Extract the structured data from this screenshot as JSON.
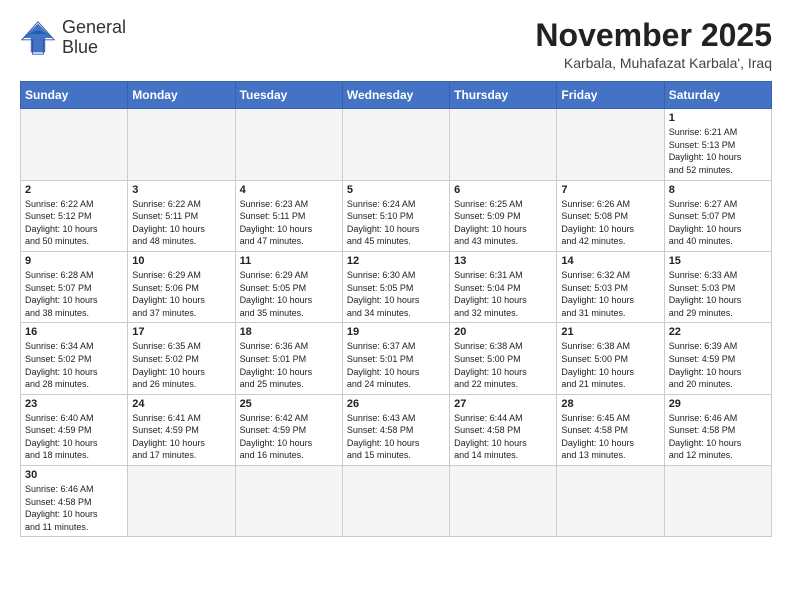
{
  "header": {
    "logo_line1": "General",
    "logo_line2": "Blue",
    "month_title": "November 2025",
    "location": "Karbala, Muhafazat Karbala', Iraq"
  },
  "weekdays": [
    "Sunday",
    "Monday",
    "Tuesday",
    "Wednesday",
    "Thursday",
    "Friday",
    "Saturday"
  ],
  "days": [
    {
      "date": "",
      "info": ""
    },
    {
      "date": "",
      "info": ""
    },
    {
      "date": "",
      "info": ""
    },
    {
      "date": "",
      "info": ""
    },
    {
      "date": "",
      "info": ""
    },
    {
      "date": "",
      "info": ""
    },
    {
      "date": "1",
      "info": "Sunrise: 6:21 AM\nSunset: 5:13 PM\nDaylight: 10 hours\nand 52 minutes."
    },
    {
      "date": "2",
      "info": "Sunrise: 6:22 AM\nSunset: 5:12 PM\nDaylight: 10 hours\nand 50 minutes."
    },
    {
      "date": "3",
      "info": "Sunrise: 6:22 AM\nSunset: 5:11 PM\nDaylight: 10 hours\nand 48 minutes."
    },
    {
      "date": "4",
      "info": "Sunrise: 6:23 AM\nSunset: 5:11 PM\nDaylight: 10 hours\nand 47 minutes."
    },
    {
      "date": "5",
      "info": "Sunrise: 6:24 AM\nSunset: 5:10 PM\nDaylight: 10 hours\nand 45 minutes."
    },
    {
      "date": "6",
      "info": "Sunrise: 6:25 AM\nSunset: 5:09 PM\nDaylight: 10 hours\nand 43 minutes."
    },
    {
      "date": "7",
      "info": "Sunrise: 6:26 AM\nSunset: 5:08 PM\nDaylight: 10 hours\nand 42 minutes."
    },
    {
      "date": "8",
      "info": "Sunrise: 6:27 AM\nSunset: 5:07 PM\nDaylight: 10 hours\nand 40 minutes."
    },
    {
      "date": "9",
      "info": "Sunrise: 6:28 AM\nSunset: 5:07 PM\nDaylight: 10 hours\nand 38 minutes."
    },
    {
      "date": "10",
      "info": "Sunrise: 6:29 AM\nSunset: 5:06 PM\nDaylight: 10 hours\nand 37 minutes."
    },
    {
      "date": "11",
      "info": "Sunrise: 6:29 AM\nSunset: 5:05 PM\nDaylight: 10 hours\nand 35 minutes."
    },
    {
      "date": "12",
      "info": "Sunrise: 6:30 AM\nSunset: 5:05 PM\nDaylight: 10 hours\nand 34 minutes."
    },
    {
      "date": "13",
      "info": "Sunrise: 6:31 AM\nSunset: 5:04 PM\nDaylight: 10 hours\nand 32 minutes."
    },
    {
      "date": "14",
      "info": "Sunrise: 6:32 AM\nSunset: 5:03 PM\nDaylight: 10 hours\nand 31 minutes."
    },
    {
      "date": "15",
      "info": "Sunrise: 6:33 AM\nSunset: 5:03 PM\nDaylight: 10 hours\nand 29 minutes."
    },
    {
      "date": "16",
      "info": "Sunrise: 6:34 AM\nSunset: 5:02 PM\nDaylight: 10 hours\nand 28 minutes."
    },
    {
      "date": "17",
      "info": "Sunrise: 6:35 AM\nSunset: 5:02 PM\nDaylight: 10 hours\nand 26 minutes."
    },
    {
      "date": "18",
      "info": "Sunrise: 6:36 AM\nSunset: 5:01 PM\nDaylight: 10 hours\nand 25 minutes."
    },
    {
      "date": "19",
      "info": "Sunrise: 6:37 AM\nSunset: 5:01 PM\nDaylight: 10 hours\nand 24 minutes."
    },
    {
      "date": "20",
      "info": "Sunrise: 6:38 AM\nSunset: 5:00 PM\nDaylight: 10 hours\nand 22 minutes."
    },
    {
      "date": "21",
      "info": "Sunrise: 6:38 AM\nSunset: 5:00 PM\nDaylight: 10 hours\nand 21 minutes."
    },
    {
      "date": "22",
      "info": "Sunrise: 6:39 AM\nSunset: 4:59 PM\nDaylight: 10 hours\nand 20 minutes."
    },
    {
      "date": "23",
      "info": "Sunrise: 6:40 AM\nSunset: 4:59 PM\nDaylight: 10 hours\nand 18 minutes."
    },
    {
      "date": "24",
      "info": "Sunrise: 6:41 AM\nSunset: 4:59 PM\nDaylight: 10 hours\nand 17 minutes."
    },
    {
      "date": "25",
      "info": "Sunrise: 6:42 AM\nSunset: 4:59 PM\nDaylight: 10 hours\nand 16 minutes."
    },
    {
      "date": "26",
      "info": "Sunrise: 6:43 AM\nSunset: 4:58 PM\nDaylight: 10 hours\nand 15 minutes."
    },
    {
      "date": "27",
      "info": "Sunrise: 6:44 AM\nSunset: 4:58 PM\nDaylight: 10 hours\nand 14 minutes."
    },
    {
      "date": "28",
      "info": "Sunrise: 6:45 AM\nSunset: 4:58 PM\nDaylight: 10 hours\nand 13 minutes."
    },
    {
      "date": "29",
      "info": "Sunrise: 6:46 AM\nSunset: 4:58 PM\nDaylight: 10 hours\nand 12 minutes."
    },
    {
      "date": "30",
      "info": "Sunrise: 6:46 AM\nSunset: 4:58 PM\nDaylight: 10 hours\nand 11 minutes."
    },
    {
      "date": "",
      "info": ""
    },
    {
      "date": "",
      "info": ""
    },
    {
      "date": "",
      "info": ""
    },
    {
      "date": "",
      "info": ""
    },
    {
      "date": "",
      "info": ""
    },
    {
      "date": "",
      "info": ""
    }
  ]
}
